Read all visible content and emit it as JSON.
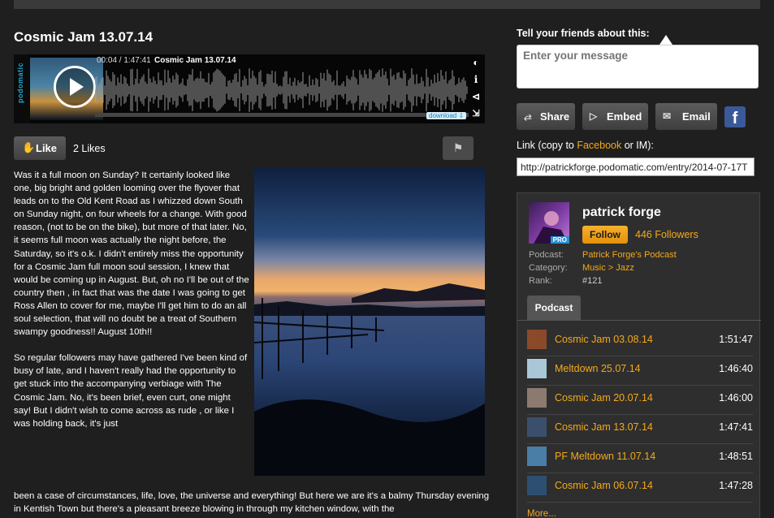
{
  "episode": {
    "title": "Cosmic Jam 13.07.14",
    "player": {
      "brand": "podomatic",
      "time": "00:04 / 1:47:41",
      "track_title": "Cosmic Jam 13.07.14",
      "download_label": "download",
      "progress_fraction": 0.0006
    },
    "like_label": "Like",
    "likes_text": "2 Likes",
    "body_paragraph_1": "Was it a full moon on Sunday? It certainly looked like one, big bright and golden looming over the flyover that leads on to the Old Kent Road as I whizzed down South on Sunday night, on four wheels for a change. With good reason, (not to be on the bike), but more of that later. No, it seems full moon was actually the night before, the Saturday, so it's o.k. I didn't entirely miss the opportunity for a Cosmic Jam full moon soul session, I knew that would be coming up in August. But, oh no I'll be out of the country then , in fact that was the date I was going to get Ross Allen to cover for me, maybe I'll get him to do an all soul selection, that will no doubt be a treat of Southern swampy goodness!! August 10th!!",
    "body_paragraph_2": "So regular followers may have gathered I've been kind of busy of late, and I haven't really had the opportunity to get stuck into the accompanying verbiage with The Cosmic Jam. No, it's been brief, even curt, one might say! But I didn't wish to come across as rude , or like I was holding back, it's just",
    "body_paragraph_2_cont": "been a case of circumstances, life, love, the universe and everything! But here we are it's a balmy Thursday evening in Kentish Town but there's a pleasant breeze blowing in through my kitchen window, with the"
  },
  "share": {
    "heading": "Tell your friends about this:",
    "message_placeholder": "Enter your message",
    "share_label": "Share",
    "embed_label": "Embed",
    "email_label": "Email",
    "facebook_glyph": "f",
    "link_label_pre": "Link (copy to ",
    "link_label_facebook": "Facebook",
    "link_label_post": " or IM):",
    "link_value": "http://patrickforge.podomatic.com/entry/2014-07-17T"
  },
  "profile": {
    "name": "patrick forge",
    "pro_badge": "PRO",
    "follow_label": "Follow",
    "followers": "446 Followers",
    "podcast_label": "Podcast:",
    "podcast_value": "Patrick Forge's Podcast",
    "category_label": "Category:",
    "category_value": "Music > Jazz",
    "rank_label": "Rank:",
    "rank_value": "#121",
    "tab_label": "Podcast",
    "episodes": [
      {
        "title": "Cosmic Jam 03.08.14",
        "duration": "1:51:47",
        "color": "#8a4a2a"
      },
      {
        "title": "Meltdown 25.07.14",
        "duration": "1:46:40",
        "color": "#a9c7d6"
      },
      {
        "title": "Cosmic Jam 20.07.14",
        "duration": "1:46:00",
        "color": "#8c7a70"
      },
      {
        "title": "Cosmic Jam 13.07.14",
        "duration": "1:47:41",
        "color": "#3b4f6c"
      },
      {
        "title": "PF Meltdown 11.07.14",
        "duration": "1:48:51",
        "color": "#4a7ea6"
      },
      {
        "title": "Cosmic Jam 06.07.14",
        "duration": "1:47:28",
        "color": "#2c4f72"
      }
    ],
    "more_label": "More..."
  },
  "colors": {
    "background": "#1f1f1f",
    "accent_orange": "#f4a91b",
    "facebook_blue": "#3b5998"
  },
  "icons": [
    "play-icon",
    "volume-icon",
    "info-icon",
    "share-icon",
    "fullscreen-icon",
    "thumb-up-icon",
    "flag-icon",
    "share-nodes-icon",
    "embed-icon",
    "email-icon",
    "facebook-icon"
  ]
}
